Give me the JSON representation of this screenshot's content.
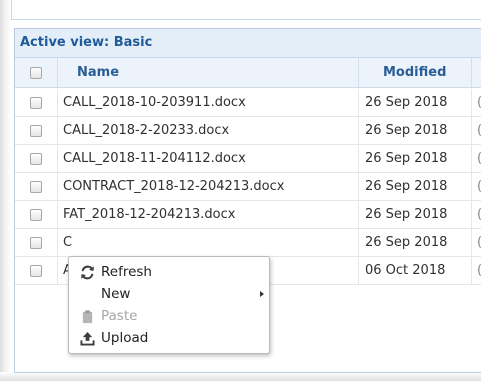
{
  "view": {
    "title": "Active view: Basic"
  },
  "columns": {
    "name": "Name",
    "modified": "Modified",
    "third_partial": "("
  },
  "files": [
    {
      "name": "CALL_2018-10-203911.docx",
      "modified": "26 Sep 2018",
      "extra": "("
    },
    {
      "name": "CALL_2018-2-20233.docx",
      "modified": "26 Sep 2018",
      "extra": "("
    },
    {
      "name": "CALL_2018-11-204112.docx",
      "modified": "26 Sep 2018",
      "extra": "("
    },
    {
      "name": "CONTRACT_2018-12-204213.docx",
      "modified": "26 Sep 2018",
      "extra": "("
    },
    {
      "name": "FAT_2018-12-204213.docx",
      "modified": "26 Sep 2018",
      "extra": "("
    },
    {
      "name": "C",
      "modified": "26 Sep 2018",
      "extra": "("
    },
    {
      "name": "A",
      "modified": "06 Oct 2018",
      "extra": "("
    }
  ],
  "context_menu": {
    "items": [
      {
        "label": "Refresh",
        "icon": "refresh-icon",
        "enabled": true
      },
      {
        "label": "New",
        "icon": "",
        "enabled": true,
        "submenu": true
      },
      {
        "label": "Paste",
        "icon": "paste-icon",
        "enabled": false
      },
      {
        "label": "Upload",
        "icon": "upload-icon",
        "enabled": true
      }
    ]
  },
  "colors": {
    "header_text": "#1f5a9a",
    "header_bg": "#e4eef8",
    "column_header_bg": "#ecf3fa",
    "disabled_text": "#a6a6a6"
  }
}
